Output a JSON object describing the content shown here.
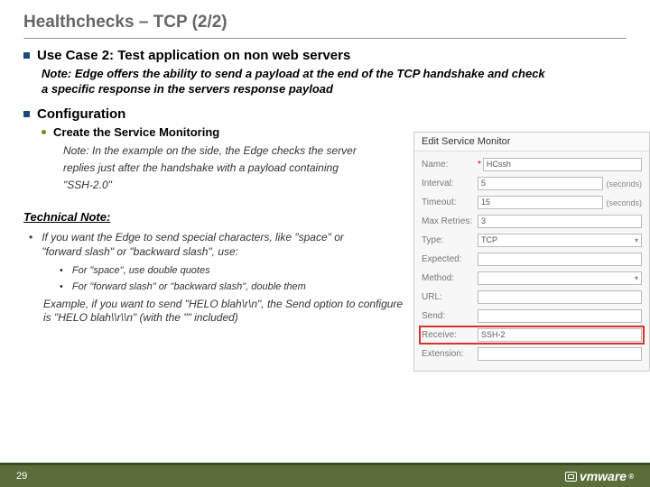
{
  "title": "Healthchecks – TCP (2/2)",
  "usecase": {
    "heading": "Use Case 2: Test application on non web servers",
    "note": "Note: Edge offers the ability to send a payload at the end of the TCP handshake and check a specific response in the servers response payload"
  },
  "config": {
    "heading": "Configuration",
    "sub_heading": "Create the Service Monitoring",
    "sub_note": "Note: In the example on the side, the Edge checks the server replies just after the handshake with a payload containing \"SSH-2.0\""
  },
  "tech": {
    "heading": "Technical Note:",
    "line1": "If you want the Edge to send special characters, like \"space\" or \"forward slash\" or \"backward slash\", use:",
    "sub1": "For \"space\", use double quotes",
    "sub2": "For \"forward slash\" or \"backward slash\", double them",
    "example": "Example, if you want to send \"HELO blah\\r\\n\", the Send option to configure is \"HELO blah\\\\r\\\\n\" (with the \"\" included)"
  },
  "dialog": {
    "title": "Edit Service Monitor",
    "rows": {
      "name_label": "Name:",
      "name_value": "HCssh",
      "interval_label": "Interval:",
      "interval_value": "5",
      "interval_unit": "(seconds)",
      "timeout_label": "Timeout:",
      "timeout_value": "15",
      "timeout_unit": "(seconds)",
      "maxretries_label": "Max Retries:",
      "maxretries_value": "3",
      "type_label": "Type:",
      "type_value": "TCP",
      "expected_label": "Expected:",
      "expected_value": "",
      "method_label": "Method:",
      "method_value": "",
      "url_label": "URL:",
      "url_value": "",
      "send_label": "Send:",
      "send_value": "",
      "receive_label": "Receive:",
      "receive_value": "SSH-2",
      "extension_label": "Extension:",
      "extension_value": ""
    }
  },
  "footer": {
    "page": "29",
    "logo": "vmware"
  }
}
